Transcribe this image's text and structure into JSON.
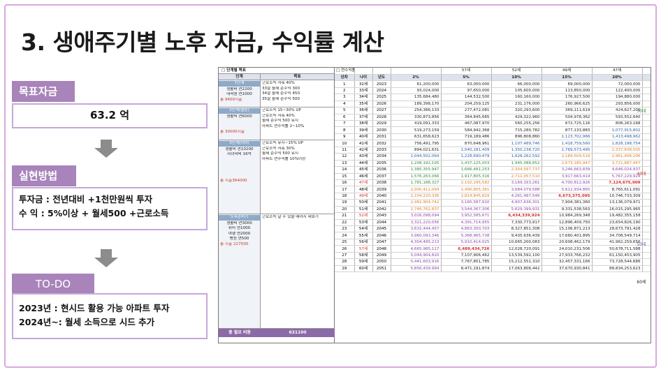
{
  "slide": {
    "title": "3. 생애주기별 노후 자금, 수익률 계산"
  },
  "goal": {
    "label": "목표자금",
    "value": "63.2 억"
  },
  "method": {
    "label": "실현방법",
    "lines": [
      "투자금 : 전년대비 +1천만원씩 투자",
      "수  익 : 5%이상 + 월세500 +근로소득"
    ]
  },
  "todo": {
    "label": "TO-DO",
    "lines": [
      "2023년 : 현시드 활용 가능 아파트 투자",
      "2024년~: 월세 소득으로 시드 추가"
    ]
  },
  "sheet": {
    "left_title": "□ 단계별 목표",
    "left_headers": [
      "단계",
      "목표"
    ],
    "sections": [
      {
        "stage": [
          "1단계",
          "생활비 연2200",
          "대학원 연1000",
          "총 9600지출"
        ],
        "goals": [
          "근로소득 저축 40%",
          "33살 월세 순수익 300",
          "34살 월세 순수익 450",
          "35살 월세 순수익 500"
        ]
      },
      {
        "stage": [
          "2단계(결혼)",
          "생활비 연6000",
          "",
          "",
          "총 30000지출"
        ],
        "goals": [
          "근로소득 15~30% UP",
          "근로소득 저축 40%",
          "월세 순수익 500 유지",
          "아파트 연수익률 2~10%"
        ]
      },
      {
        "stage": [
          "3단계(자녀)",
          "생활비 연10200",
          "자녀학비 16억",
          "",
          "",
          "",
          "",
          "총 지출364000"
        ],
        "goals": [
          "근로소득 유지~15% UP",
          "근로소득 저축 30%",
          "월세 순수익 500 유지",
          "아파트 연수익률 10%이상"
        ]
      },
      {
        "stage": [
          "노후준비기",
          "생활비 연3000",
          "취미 연1000",
          "여행 연2000",
          "병원 연500",
          "총 지출 227500"
        ],
        "goals": [
          "근로소득 날 수 있을 때까지 내보기"
        ]
      }
    ],
    "total": {
      "label": "총 필요 비용",
      "value": "631100"
    },
    "top_labels": [
      "□ 연수익률",
      "",
      "",
      "",
      "57세",
      "52세",
      "49세",
      "47세",
      ""
    ],
    "headers": [
      "년차",
      "나이",
      "년도",
      "2%",
      "5%",
      "10%",
      "15%",
      "20%",
      "연령"
    ],
    "rows": [
      {
        "n": "1",
        "age": "32세",
        "year": "2023",
        "v": [
          "61,200,000",
          "63,000,000",
          "66,000,000",
          "69,000,000",
          "72,000,000"
        ],
        "c": [
          "gray",
          "gray",
          "gray",
          "gray",
          "gray"
        ]
      },
      {
        "n": "2",
        "age": "33세",
        "year": "2024",
        "v": [
          "93,024,000",
          "97,650,000",
          "105,600,000",
          "113,850,000",
          "122,400,000"
        ],
        "c": [
          "gray",
          "gray",
          "gray",
          "gray",
          "gray"
        ]
      },
      {
        "n": "3",
        "age": "34세",
        "year": "2025",
        "v": [
          "135,684,480",
          "144,532,500",
          "160,160,000",
          "176,927,500",
          "194,880,000"
        ],
        "c": [
          "gray",
          "gray",
          "gray",
          "gray",
          "gray"
        ]
      },
      {
        "n": "4",
        "age": "35세",
        "year": "2026",
        "v": [
          "189,398,170",
          "204,259,125",
          "231,176,000",
          "260,966,625",
          "293,856,000"
        ],
        "c": [
          "gray",
          "gray",
          "gray",
          "gray",
          "gray"
        ]
      },
      {
        "n": "5",
        "age": "36세",
        "year": "2027",
        "v": [
          "254,386,133",
          "277,472,081",
          "320,293,600",
          "369,111,619",
          "424,627,200"
        ],
        "c": [
          "gray",
          "gray",
          "gray",
          "gray",
          "gray"
        ]
      },
      {
        "n": "6",
        "age": "37세",
        "year": "2028",
        "v": [
          "330,873,856",
          "364,845,685",
          "429,322,960",
          "504,978,362",
          "593,552,640"
        ],
        "c": [
          "gray",
          "gray",
          "gray",
          "gray",
          "gray"
        ]
      },
      {
        "n": "7",
        "age": "38세",
        "year": "2029",
        "v": [
          "419,091,333",
          "467,087,970",
          "560,255,256",
          "672,725,116",
          "808,263,168"
        ],
        "c": [
          "gray",
          "gray",
          "gray",
          "gray",
          "gray"
        ]
      },
      {
        "n": "8",
        "age": "39세",
        "year": "2030",
        "v": [
          "519,273,159",
          "584,942,368",
          "715,280,782",
          "877,133,883",
          "1,077,915,802"
        ],
        "c": [
          "gray",
          "gray",
          "gray",
          "gray",
          "blue"
        ]
      },
      {
        "n": "9",
        "age": "40세",
        "year": "2031",
        "v": [
          "631,658,623",
          "719,189,486",
          "896,808,860",
          "1,123,702,966",
          "1,413,498,962"
        ],
        "c": [
          "gray",
          "gray",
          "gray",
          "blue",
          "blue"
        ]
      },
      {
        "n": "10",
        "age": "41세",
        "year": "2032",
        "v": [
          "756,491,795",
          "870,648,961",
          "1,107,489,746",
          "1,418,759,560",
          "1,828,198,754"
        ],
        "c": [
          "gray",
          "gray",
          "blue",
          "blue",
          "blue"
        ]
      },
      {
        "n": "11",
        "age": "42세",
        "year": "2033",
        "v": [
          "894,021,631",
          "1,040,181,409",
          "1,350,238,720",
          "1,769,573,495",
          "2,337,838,505"
        ],
        "c": [
          "gray",
          "blue",
          "blue",
          "blue",
          "orange"
        ]
      },
      {
        "n": "12",
        "age": "43세",
        "year": "2034",
        "v": [
          "1,044,502,064",
          "1,228,690,479",
          "1,628,262,592",
          "2,184,509,519",
          "2,961,406,206"
        ],
        "c": [
          "blue",
          "blue",
          "blue",
          "orange",
          "orange"
        ]
      },
      {
        "n": "13",
        "age": "44세",
        "year": "2035",
        "v": [
          "1,208,192,105",
          "1,437,125,003",
          "1,945,088,852",
          "2,673,185,947",
          "3,721,687,447"
        ],
        "c": [
          "green",
          "green",
          "green",
          "orange",
          "orange"
        ]
      },
      {
        "n": "14",
        "age": "45세",
        "year": "2036",
        "v": [
          "1,385,355,947",
          "1,666,481,253",
          "2,304,597,737",
          "3,246,663,839",
          "4,646,024,937"
        ],
        "c": [
          "green",
          "green",
          "orange",
          "purple",
          "purple"
        ]
      },
      {
        "n": "15",
        "age": "46세",
        "year": "2037",
        "v": [
          "1,576,263,066",
          "1,917,805,316",
          "2,711,057,510",
          "3,917,663,414",
          "5,767,229,924"
        ],
        "c": [
          "green",
          "green",
          "orange",
          "purple",
          "purple"
        ]
      },
      {
        "n": "16",
        "age": "47세",
        "year": "2038",
        "v": [
          "1,781,188,327",
          "2,192,195,582",
          "3,169,163,261",
          "4,700,812,926",
          "7,124,675,909"
        ],
        "c": [
          "green",
          "orange",
          "purple",
          "purple",
          "red"
        ]
      },
      {
        "n": "17",
        "age": "48세",
        "year": "2039",
        "v": [
          "2,000,412,094",
          "2,490,805,361",
          "3,684,079,588",
          "5,612,934,865",
          "8,765,611,091"
        ],
        "c": [
          "orange",
          "orange",
          "purple",
          "purple",
          "gray"
        ]
      },
      {
        "n": "18",
        "age": "49세",
        "year": "2040",
        "v": [
          "2,234,220,336",
          "2,814,845,629",
          "4,261,487,546",
          "6,673,375,095",
          "10,746,733,309"
        ],
        "c": [
          "orange",
          "orange",
          "purple",
          "red",
          "gray"
        ]
      },
      {
        "n": "19",
        "age": "50세",
        "year": "2041",
        "v": [
          "2,482,904,742",
          "3,165,587,910",
          "4,907,636,301",
          "7,904,381,360",
          "13,136,079,971"
        ],
        "c": [
          "orange",
          "purple",
          "purple",
          "gray",
          "gray"
        ]
      },
      {
        "n": "20",
        "age": "51세",
        "year": "2042",
        "v": [
          "2,746,762,837",
          "3,544,367,306",
          "5,629,399,931",
          "9,331,538,563",
          "16,015,295,965"
        ],
        "c": [
          "orange",
          "purple",
          "purple",
          "gray",
          "gray"
        ]
      },
      {
        "n": "21",
        "age": "52세",
        "year": "2043",
        "v": [
          "3,026,098,094",
          "3,952,585,671",
          "6,434,339,924",
          "10,984,269,348",
          "19,482,355,158"
        ],
        "c": [
          "purple",
          "purple",
          "red",
          "gray",
          "gray"
        ]
      },
      {
        "n": "22",
        "age": "53세",
        "year": "2044",
        "v": [
          "3,321,220,056",
          "4,391,714,955",
          "7,330,773,917",
          "12,896,409,750",
          "23,654,826,190"
        ],
        "c": [
          "purple",
          "purple",
          "gray",
          "gray",
          "gray"
        ]
      },
      {
        "n": "23",
        "age": "54세",
        "year": "2045",
        "v": [
          "3,632,444,457",
          "4,863,300,703",
          "8,327,851,308",
          "15,106,871,213",
          "28,673,791,428"
        ],
        "c": [
          "purple",
          "purple",
          "gray",
          "gray",
          "gray"
        ]
      },
      {
        "n": "24",
        "age": "55세",
        "year": "2046",
        "v": [
          "3,960,093,346",
          "5,368,965,738",
          "9,435,636,439",
          "17,660,401,895",
          "34,708,549,714"
        ],
        "c": [
          "purple",
          "purple",
          "gray",
          "gray",
          "gray"
        ]
      },
      {
        "n": "25",
        "age": "56세",
        "year": "2047",
        "v": [
          "4,304,495,213",
          "5,910,414,025",
          "10,665,200,083",
          "20,608,462,179",
          "41,962,259,656"
        ],
        "c": [
          "purple",
          "purple",
          "gray",
          "gray",
          "gray"
        ]
      },
      {
        "n": "26",
        "age": "57세",
        "year": "2048",
        "v": [
          "4,665,985,117",
          "6,489,434,726",
          "12,028,720,091",
          "24,010,231,506",
          "50,678,711,588"
        ],
        "c": [
          "purple",
          "red",
          "gray",
          "gray",
          "gray"
        ]
      },
      {
        "n": "27",
        "age": "58세",
        "year": "2049",
        "v": [
          "5,044,904,820",
          "7,107,906,462",
          "13,539,592,100",
          "27,933,766,232",
          "61,150,453,905"
        ],
        "c": [
          "purple",
          "gray",
          "gray",
          "gray",
          "gray"
        ]
      },
      {
        "n": "28",
        "age": "59세",
        "year": "2050",
        "v": [
          "5,441,603,916",
          "7,767,801,785",
          "15,212,551,310",
          "32,457,331,166",
          "73,728,544,686"
        ],
        "c": [
          "purple",
          "gray",
          "gray",
          "gray",
          "gray"
        ]
      },
      {
        "n": "29",
        "age": "60세",
        "year": "2051",
        "v": [
          "5,856,439,994",
          "8,471,191,874",
          "17,063,806,442",
          "37,670,930,841",
          "88,834,253,623"
        ],
        "c": [
          "purple",
          "gray",
          "gray",
          "gray",
          "gray"
        ]
      }
    ],
    "decades": [
      {
        "label": "30대",
        "color": "#2f8a3a"
      },
      {
        "label": "40대",
        "color": "#d62b2b"
      },
      {
        "label": "50대",
        "color": "#7a52b0"
      },
      {
        "label": "60세",
        "color": "#222222"
      }
    ]
  }
}
